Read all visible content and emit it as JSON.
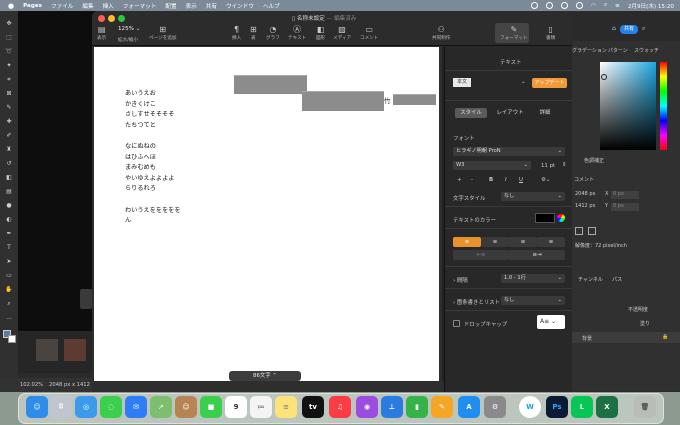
{
  "menubar": {
    "app_name": "Pages",
    "items": [
      "ファイル",
      "編集",
      "挿入",
      "フォーマット",
      "配置",
      "表示",
      "共有",
      "ウインドウ",
      "ヘルプ"
    ],
    "datetime": "2月9日(木) 15:20"
  },
  "window": {
    "title": "名称未設定",
    "title_status": "— 編集済み",
    "zoom": "125%",
    "toolbar": {
      "view": "表示",
      "zoom_label": "拡大/縮小",
      "add_page": "ページを追加",
      "insert": "挿入",
      "table": "表",
      "chart": "グラフ",
      "text": "テキスト",
      "shape": "図形",
      "media": "メディア",
      "comment": "コメント",
      "collaborate": "共同制作",
      "format": "フォーマット",
      "document": "書類"
    }
  },
  "document": {
    "lines": [
      "あいうえお",
      "かきくけこ",
      "さしすせそそそそ",
      "たちつてと",
      "",
      "なにぬねの",
      "はひふへほ",
      "まみむめも",
      "やいゆえよよよよ",
      "らりるれろ",
      "",
      "わいうえををををを",
      "ん"
    ],
    "side_char": "竹",
    "word_count": "86文字"
  },
  "inspector": {
    "header": "テキスト",
    "style_name": "本文",
    "update_button": "アップデート",
    "tabs": [
      "スタイル",
      "レイアウト",
      "詳細"
    ],
    "font_label": "フォント",
    "font_family": "ヒラギノ明朝 ProN",
    "font_weight": "W3",
    "font_size": "11 pt",
    "char_style_label": "文字スタイル",
    "char_style_value": "なし",
    "text_color_label": "テキストのカラー",
    "spacing_label": "間隔",
    "spacing_value": "1.0 - 1行",
    "bullets_label": "箇条書きとリスト",
    "bullets_value": "なし",
    "dropcap_label": "ドロップキャップ"
  },
  "photoshop": {
    "share_label": "共有",
    "panel_tabs": [
      "グラデーション",
      "パターン",
      "スウォッチ"
    ],
    "adjust_label": "色調補正",
    "properties_label": "コメント",
    "width": "2048 px",
    "height": "1412 px",
    "x_label": "X",
    "y_label": "Y",
    "x_placeholder": "0 px",
    "y_placeholder": "0 px",
    "resolution": "解像度：72 pixel/inch",
    "channels": "チャンネル",
    "paths": "パス",
    "opacity_label": "不透明度",
    "fill_label": "塗り",
    "layer_name": "背景",
    "zoom": "102.02%",
    "doc_size": "2048 px x 1412"
  },
  "dock": {
    "apps": [
      "Finder",
      "Launchpad",
      "Safari",
      "メッセージ",
      "メール",
      "マップ",
      "Notes",
      "FaceTime",
      "カレンダー",
      "リマインダー",
      "メモ",
      "TV",
      "ミュージック",
      "Podcast",
      "Keynote",
      "Numbers",
      "Pages",
      "App Store",
      "システム環境設定",
      "W",
      "Photoshop",
      "LINE",
      "Excel",
      "ゴミ箱"
    ],
    "calendar_day": "9"
  }
}
